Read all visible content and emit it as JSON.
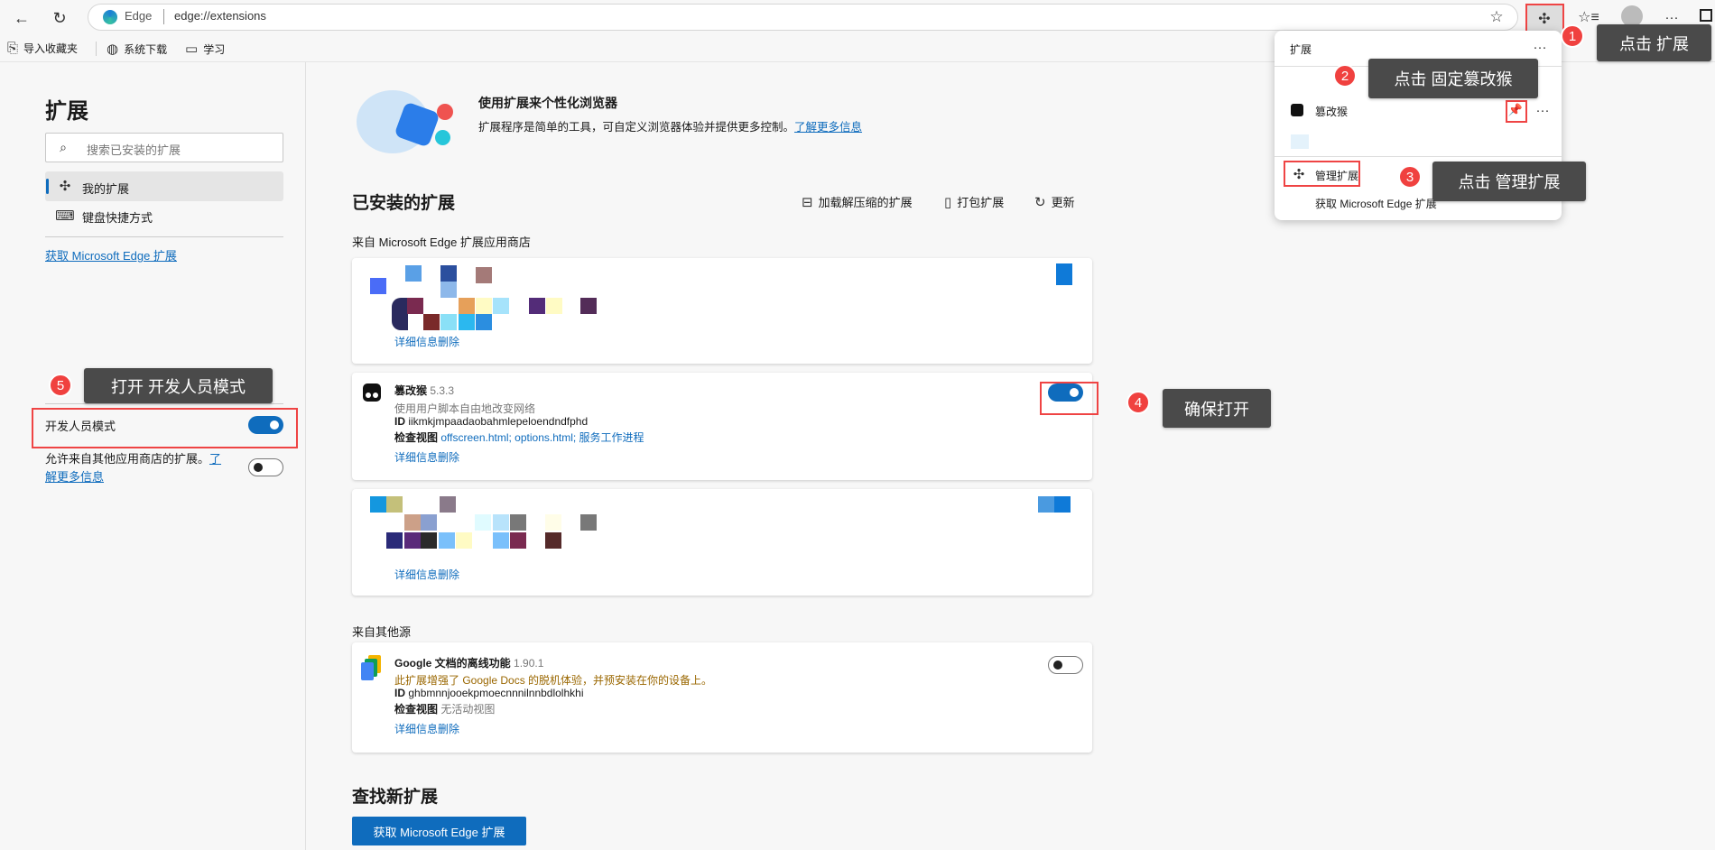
{
  "browser": {
    "site_label": "Edge",
    "url": "edge://extensions"
  },
  "bookmarks": [
    {
      "label": "导入收藏夹",
      "icon": "import-icon"
    },
    {
      "label": "系统下载",
      "icon": "globe-icon"
    },
    {
      "label": "学习",
      "icon": "folder-icon"
    }
  ],
  "sidebar": {
    "title": "扩展",
    "search_placeholder": "搜索已安装的扩展",
    "items": [
      {
        "label": "我的扩展",
        "icon": "puzzle-icon"
      },
      {
        "label": "键盘快捷方式",
        "icon": "keyboard-icon"
      }
    ],
    "get_link": "获取 Microsoft Edge 扩展",
    "dev_mode_label": "开发人员模式",
    "dev_mode_on": true,
    "allow_other_text": "允许来自其他应用商店的扩展。",
    "allow_other_link_1": "了",
    "allow_other_link_2": "解更多信息",
    "allow_other_on": false
  },
  "hero": {
    "title": "使用扩展来个性化浏览器",
    "desc": "扩展程序是简单的工具，可自定义浏览器体验并提供更多控制。",
    "link": "了解更多信息"
  },
  "installed": {
    "heading": "已安装的扩展",
    "actions": [
      "加载解压缩的扩展",
      "打包扩展",
      "更新"
    ],
    "store_section": "来自 Microsoft Edge 扩展应用商店",
    "other_section": "来自其他源"
  },
  "common": {
    "details": "详细信息",
    "remove": "删除",
    "id_label": "ID",
    "inspect_label": "检查视图"
  },
  "tampermonkey": {
    "name": "篡改猴",
    "version": "5.3.3",
    "desc": "使用用户脚本自由地改变网络",
    "id": "iikmkjmpaadaobahmlepeloendndfphd",
    "views": "offscreen.html; options.html; 服务工作进程",
    "enabled": true
  },
  "gdocs": {
    "name": "Google 文档的离线功能",
    "version": "1.90.1",
    "desc": "此扩展增强了 Google Docs 的脱机体验，并预安装在你的设备上。",
    "id": "ghbmnnjooekpmoecnnnilnnbdlolhkhi",
    "views": "无活动视图",
    "enabled": false
  },
  "find": {
    "heading": "查找新扩展",
    "button": "获取 Microsoft Edge 扩展"
  },
  "popup": {
    "title": "扩展",
    "item": "篡改猴",
    "manage": "管理扩展",
    "get": "获取 Microsoft Edge 扩展"
  },
  "annotations": [
    {
      "n": "1",
      "text": "点击 扩展"
    },
    {
      "n": "2",
      "text": "点击 固定篡改猴"
    },
    {
      "n": "3",
      "text": "点击 管理扩展"
    },
    {
      "n": "4",
      "text": "确保打开"
    },
    {
      "n": "5",
      "text": "打开 开发人员模式"
    }
  ],
  "colors": {
    "accent": "#0f6cbd",
    "annotation": "#f0413f",
    "tooltip": "#4a4a4a",
    "warning_text": "#9a6700"
  }
}
